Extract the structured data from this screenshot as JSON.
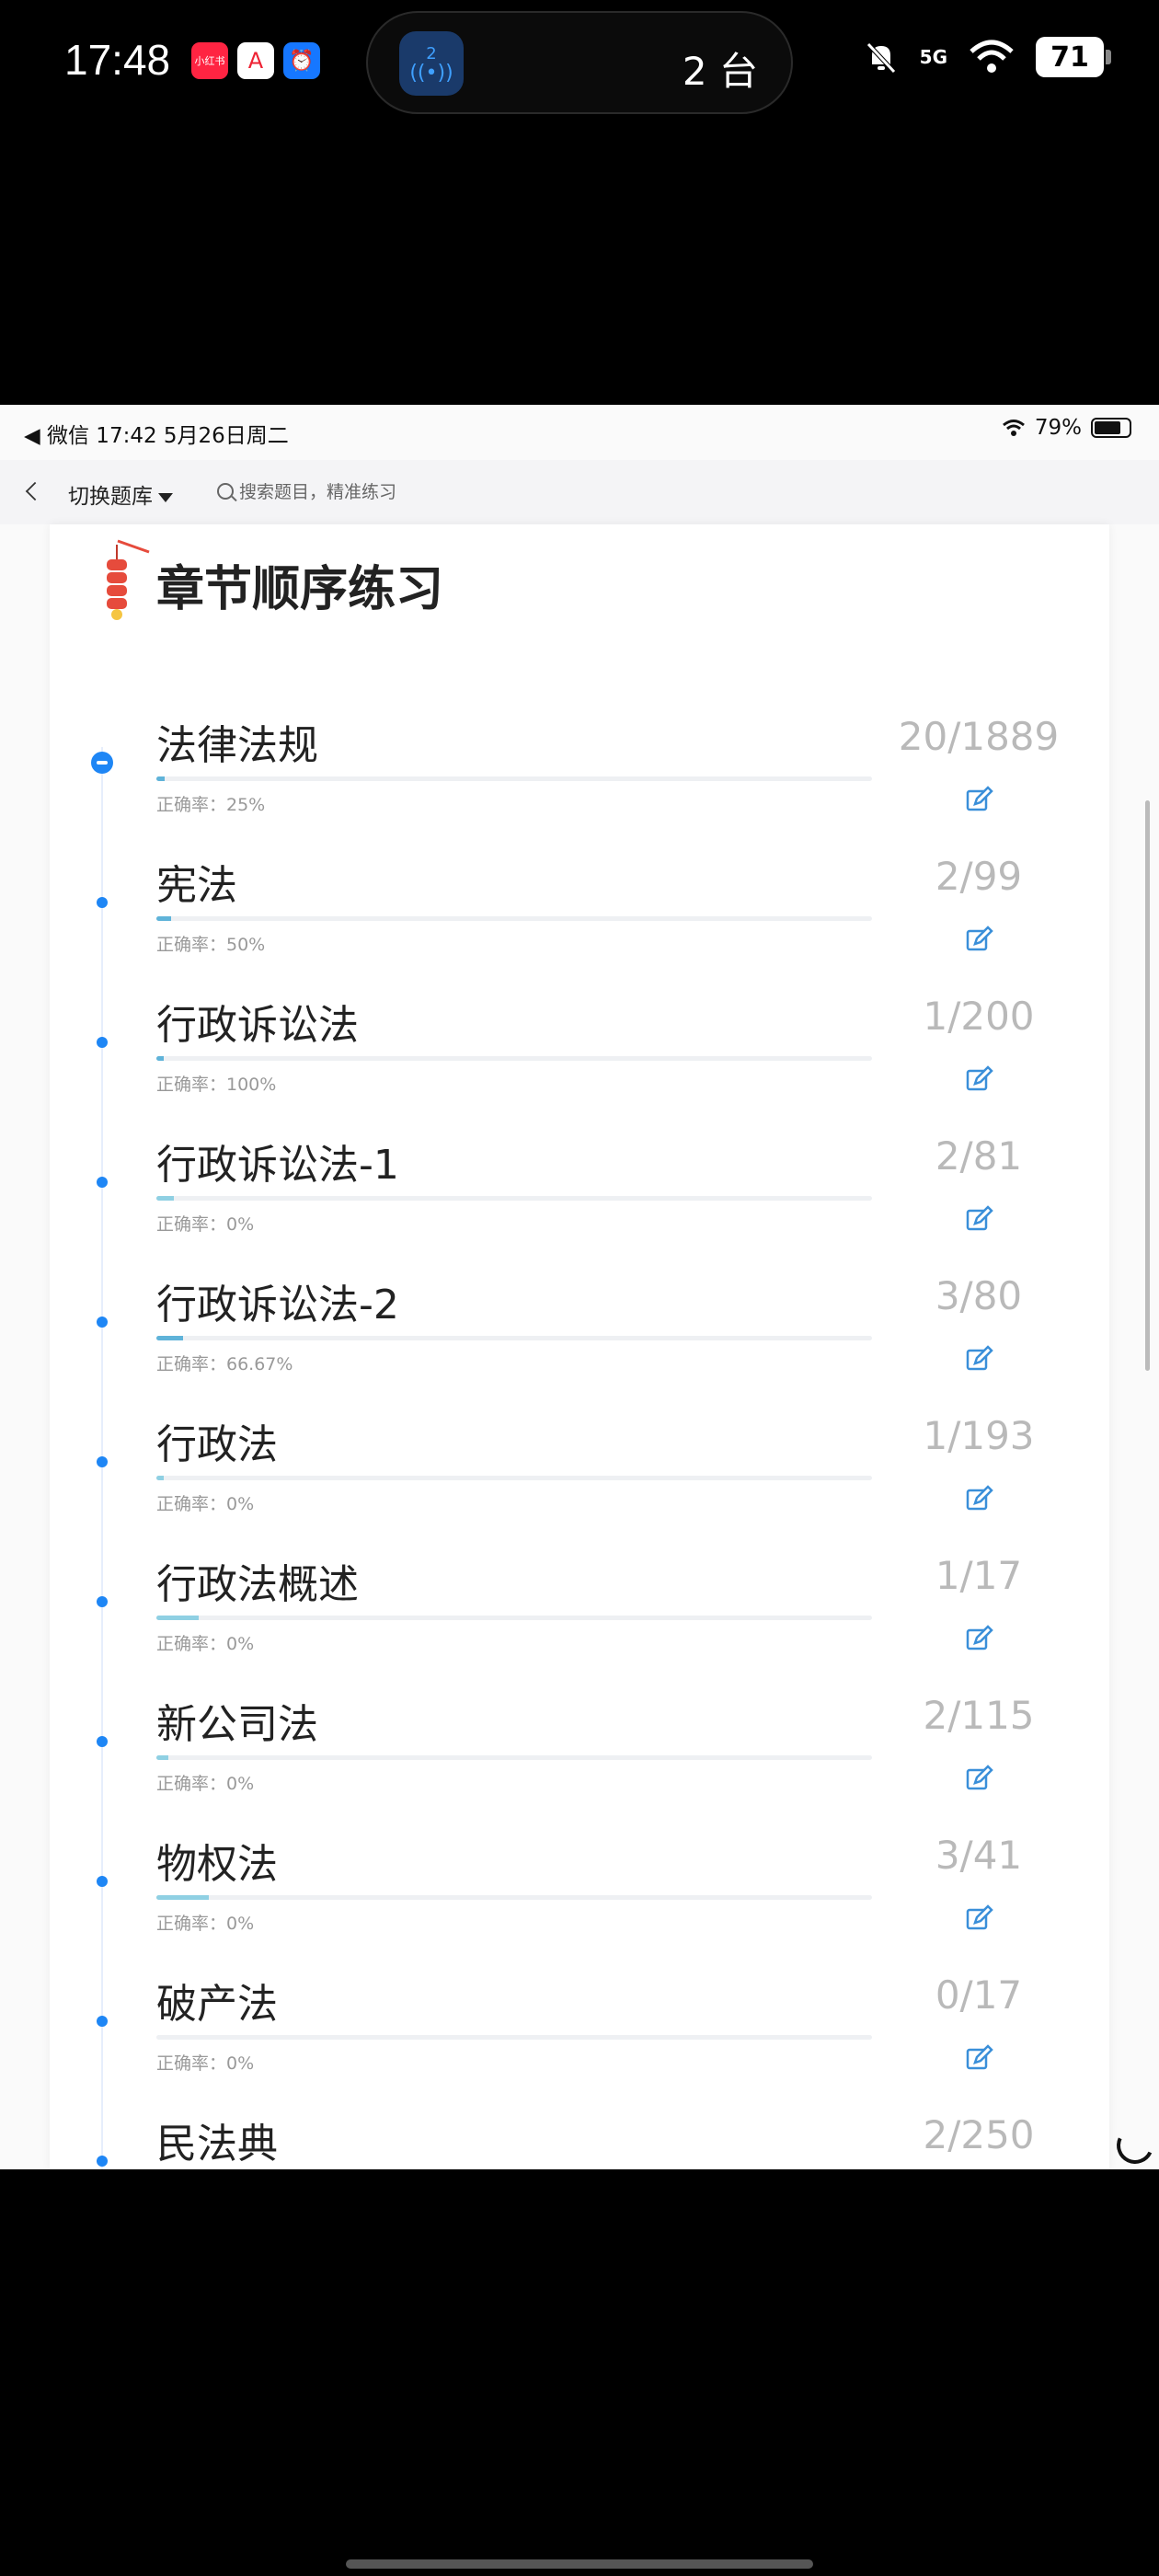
{
  "phone_status": {
    "time": "17:48",
    "app_icons": [
      "小红书",
      "A",
      "⏰"
    ],
    "island_badge": "2",
    "island_text": "2 台",
    "signal": "5G",
    "battery": "71"
  },
  "inner_status": {
    "left": "◀ 微信   17:42   5月26日周二",
    "battery_text": "79%"
  },
  "nav": {
    "switch_label": "切换题库",
    "search_placeholder": "搜索题目，精准练习"
  },
  "page": {
    "title": "章节顺序练习"
  },
  "chapters": [
    {
      "name": "法律法规",
      "rate": "正确率：25%",
      "count": "20/1889",
      "progress": 0.011
    },
    {
      "name": "宪法",
      "rate": "正确率：50%",
      "count": "2/99",
      "progress": 0.02
    },
    {
      "name": "行政诉讼法",
      "rate": "正确率：100%",
      "count": "1/200",
      "progress": 0.005
    },
    {
      "name": "行政诉讼法-1",
      "rate": "正确率：0%",
      "count": "2/81",
      "progress": 0.025
    },
    {
      "name": "行政诉讼法-2",
      "rate": "正确率：66.67%",
      "count": "3/80",
      "progress": 0.0375
    },
    {
      "name": "行政法",
      "rate": "正确率：0%",
      "count": "1/193",
      "progress": 0.005
    },
    {
      "name": "行政法概述",
      "rate": "正确率：0%",
      "count": "1/17",
      "progress": 0.059
    },
    {
      "name": "新公司法",
      "rate": "正确率：0%",
      "count": "2/115",
      "progress": 0.017
    },
    {
      "name": "物权法",
      "rate": "正确率：0%",
      "count": "3/41",
      "progress": 0.073
    },
    {
      "name": "破产法",
      "rate": "正确率：0%",
      "count": "0/17",
      "progress": 0
    },
    {
      "name": "民法典",
      "rate": "",
      "count": "2/250",
      "progress": 0.008
    }
  ],
  "colors": {
    "accent": "#1e86f5",
    "progress": "#8fd0e3",
    "count": "#b9b9b9"
  }
}
